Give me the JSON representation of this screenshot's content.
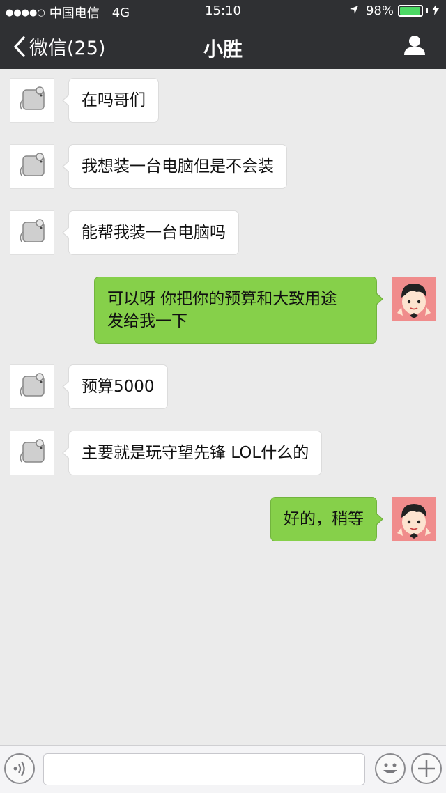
{
  "status_bar": {
    "signal": "●●●●○",
    "carrier": "中国电信",
    "network": "4G",
    "time": "15:10",
    "battery_percent": "98%",
    "battery_level": 0.98
  },
  "header": {
    "back_label": "微信(25)",
    "title": "小胜"
  },
  "messages": [
    {
      "side": "left",
      "text": "在吗哥们"
    },
    {
      "side": "left",
      "text": "我想装一台电脑但是不会装"
    },
    {
      "side": "left",
      "text": "能帮我装一台电脑吗"
    },
    {
      "side": "right",
      "line1": "可以呀 你把你的预算和大致用途",
      "line2": "发给我一下"
    },
    {
      "side": "left",
      "text": "预算5000"
    },
    {
      "side": "left",
      "text": "主要就是玩守望先锋 LOL什么的"
    },
    {
      "side": "right",
      "text": "好的，稍等"
    }
  ],
  "input": {
    "value": ""
  },
  "icons": {
    "back": "chevron-left-icon",
    "profile": "person-icon",
    "voice": "voice-icon",
    "emoji": "smiley-icon",
    "plus": "plus-icon"
  },
  "colors": {
    "header_bg": "#2f3033",
    "chat_bg": "#ebebeb",
    "my_bubble": "#86d04a",
    "their_bubble": "#ffffff",
    "battery": "#4cd964"
  }
}
